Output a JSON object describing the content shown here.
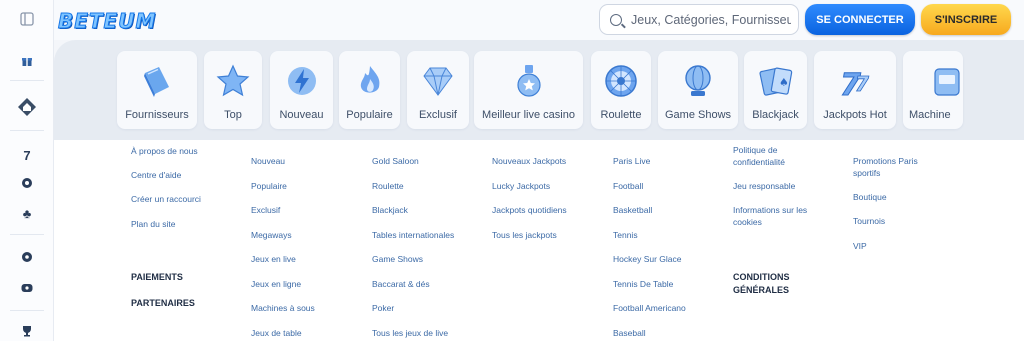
{
  "brand": {
    "logo_text": "BETEUM"
  },
  "search": {
    "placeholder": "Jeux, Catégories, Fournisseurs"
  },
  "auth": {
    "login_label": "SE CONNECTER",
    "signup_label": "S'INSCRIRE"
  },
  "rail": {
    "icons": [
      "sidebar-toggle-icon",
      "gift-icon",
      "home-icon",
      "seven-icon",
      "roulette-icon",
      "cards-icon",
      "football-icon",
      "esports-icon",
      "trophy-icon"
    ]
  },
  "categories": [
    {
      "label": "Fournisseurs",
      "icon": "book-icon"
    },
    {
      "label": "Top",
      "icon": "star-icon"
    },
    {
      "label": "Nouveau",
      "icon": "lightning-icon"
    },
    {
      "label": "Populaire",
      "icon": "flame-icon"
    },
    {
      "label": "Exclusif",
      "icon": "diamond-icon"
    },
    {
      "label": "Meilleur live casino",
      "icon": "medal-icon"
    },
    {
      "label": "Roulette",
      "icon": "roulette-icon"
    },
    {
      "label": "Game Shows",
      "icon": "globe-icon"
    },
    {
      "label": "Blackjack",
      "icon": "cards-icon"
    },
    {
      "label": "Jackpots Hot",
      "icon": "seven-icon"
    },
    {
      "label": "Machine",
      "icon": "slot-machine-icon"
    }
  ],
  "footer": {
    "col1": {
      "links": [
        "À propos de nous",
        "Centre d'aide",
        "Créer un raccourci",
        "Plan du site"
      ],
      "payments": "PAIEMENTS",
      "partners": "PARTENAIRES"
    },
    "col2": [
      "Nouveau",
      "Populaire",
      "Exclusif",
      "Megaways",
      "Jeux en live",
      "Jeux en ligne",
      "Machines à sous",
      "Jeux de table"
    ],
    "col3": [
      "Gold Saloon",
      "Roulette",
      "Blackjack",
      "Tables internationales",
      "Game Shows",
      "Baccarat & dés",
      "Poker",
      "Tous les jeux de live"
    ],
    "col4": [
      "Nouveaux Jackpots",
      "Lucky Jackpots",
      "Jackpots quotidiens",
      "Tous les jackpots"
    ],
    "col5": [
      "Paris Live",
      "Football",
      "Basketball",
      "Tennis",
      "Hockey Sur Glace",
      "Tennis De Table",
      "Football Americano",
      "Baseball"
    ],
    "col6": {
      "links": [
        "Politique de confidentialité",
        "Jeu responsable",
        "Informations sur les cookies"
      ],
      "terms": "CONDITIONS GÉNÉRALES"
    },
    "col7": [
      "Promotions Paris sportifs",
      "Boutique",
      "Tournois",
      "VIP"
    ]
  }
}
